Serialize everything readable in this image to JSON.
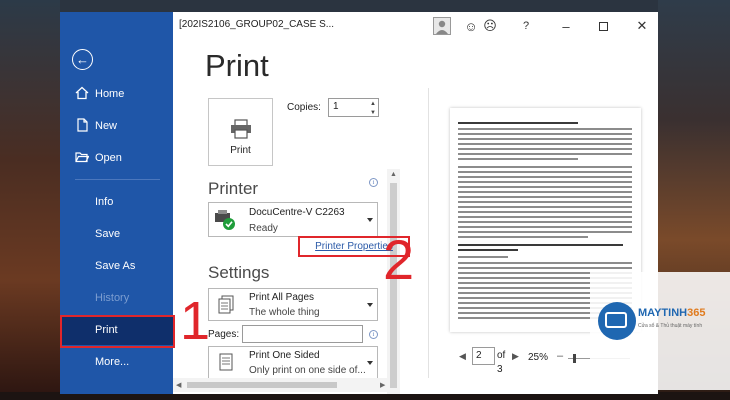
{
  "window": {
    "title": "[202IS2106_GROUP02_CASE S..."
  },
  "backstage": {
    "items": [
      {
        "label": "Home",
        "icon": "home-icon"
      },
      {
        "label": "New",
        "icon": "new-document-icon"
      },
      {
        "label": "Open",
        "icon": "open-folder-icon"
      },
      {
        "label": "Info"
      },
      {
        "label": "Save"
      },
      {
        "label": "Save As"
      },
      {
        "label": "History"
      },
      {
        "label": "Print"
      },
      {
        "label": "More..."
      }
    ],
    "selected": "Print",
    "disabled": [
      "History"
    ]
  },
  "print": {
    "heading": "Print",
    "button_label": "Print",
    "copies_label": "Copies:",
    "copies_value": "1"
  },
  "printer": {
    "heading": "Printer",
    "name": "DocuCentre-V C2263",
    "status": "Ready",
    "properties_link": "Printer Properties"
  },
  "settings": {
    "heading": "Settings",
    "range": {
      "line1": "Print All Pages",
      "line2": "The whole thing"
    },
    "pages_label": "Pages:",
    "pages_value": "",
    "sides": {
      "line1": "Print One Sided",
      "line2": "Only print on one side of..."
    }
  },
  "preview": {
    "current_page": "2",
    "of_label": "of",
    "total_pages": "3",
    "zoom": "25%"
  },
  "annotations": {
    "step1": "1",
    "step2": "2"
  },
  "watermark": {
    "brand_main": "MAYTINH",
    "brand_accent": "365",
    "tagline": "Cửa sổ & Thủ thuật máy tính"
  },
  "colors": {
    "nav_bg": "#1f56a8",
    "nav_selected": "#0f2f6b",
    "annotation_red": "#e0262b",
    "link_blue": "#2b5aa8"
  }
}
